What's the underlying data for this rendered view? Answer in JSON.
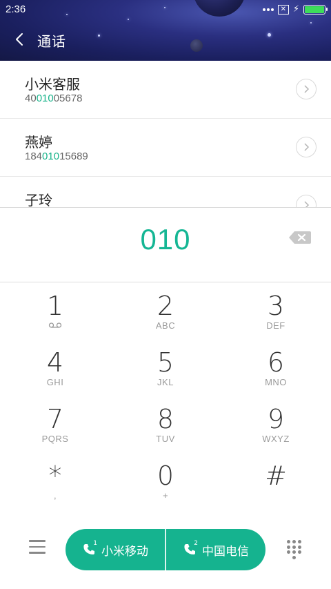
{
  "status_bar": {
    "time": "2:36",
    "battery_level": 1.0,
    "battery_color": "#3ddc5a"
  },
  "header": {
    "title": "通话",
    "back_icon": "chevron-left-icon"
  },
  "contacts": [
    {
      "name": "小米客服",
      "number_prefix": "40",
      "number_match": "010",
      "number_suffix": "05678"
    },
    {
      "name": "燕婷",
      "number_prefix": "184",
      "number_match": "010",
      "number_suffix": "15689"
    },
    {
      "name": "子玲",
      "number_prefix": "",
      "number_match": "",
      "number_suffix": ""
    }
  ],
  "dialer": {
    "digits": "010",
    "accent_color": "#15b694"
  },
  "keypad": [
    {
      "digit": "1",
      "sub": ""
    },
    {
      "digit": "2",
      "sub": "ABC"
    },
    {
      "digit": "3",
      "sub": "DEF"
    },
    {
      "digit": "4",
      "sub": "GHI"
    },
    {
      "digit": "5",
      "sub": "JKL"
    },
    {
      "digit": "6",
      "sub": "MNO"
    },
    {
      "digit": "7",
      "sub": "PQRS"
    },
    {
      "digit": "8",
      "sub": "TUV"
    },
    {
      "digit": "9",
      "sub": "WXYZ"
    },
    {
      "digit": "*",
      "sub": ","
    },
    {
      "digit": "0",
      "sub": "+"
    },
    {
      "digit": "#",
      "sub": ""
    }
  ],
  "bottom_bar": {
    "sim1_number": "1",
    "sim1_label": "小米移动",
    "sim2_number": "2",
    "sim2_label": "中国电信",
    "call_color": "#15b38f"
  }
}
